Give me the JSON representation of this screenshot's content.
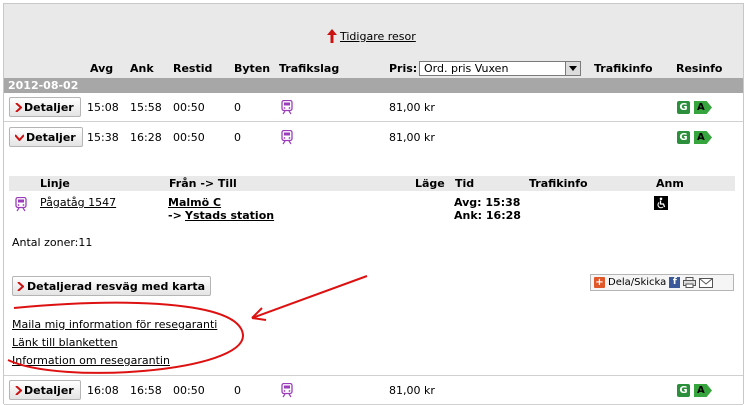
{
  "top": {
    "earlier_label": "Tidigare resor"
  },
  "columns": {
    "dep": "Avg",
    "arr": "Ank",
    "travel_time": "Restid",
    "changes": "Byten",
    "traffic_type": "Trafikslag",
    "price": "Pris:",
    "traffic_info": "Trafikinfo",
    "journey_info": "Resinfo"
  },
  "price_select": {
    "value": "Ord. pris Vuxen"
  },
  "date": "2012-08-02",
  "trips": [
    {
      "details_label": "Detaljer",
      "dep": "15:08",
      "arr": "15:58",
      "duration": "00:50",
      "changes": "0",
      "price": "81,00 kr",
      "badge_g": "G",
      "badge_a": "A"
    },
    {
      "details_label": "Detaljer",
      "dep": "15:38",
      "arr": "16:28",
      "duration": "00:50",
      "changes": "0",
      "price": "81,00 kr",
      "badge_g": "G",
      "badge_a": "A"
    },
    {
      "details_label": "Detaljer",
      "dep": "16:08",
      "arr": "16:58",
      "duration": "00:50",
      "changes": "0",
      "price": "81,00 kr",
      "badge_g": "G",
      "badge_a": "A"
    }
  ],
  "details": {
    "headers": {
      "line": "Linje",
      "from_to": "Från -> Till",
      "platform": "Läge",
      "time": "Tid",
      "traffic_info": "Trafikinfo",
      "note": "Anm"
    },
    "line": "Pågatåg 1547",
    "from": "Malmö C",
    "to_prefix": "->",
    "to": "Ystads station",
    "dep_time": "Avg: 15:38",
    "arr_time": "Ank: 16:28",
    "zones": "Antal zoner:11",
    "map_button": "Detaljerad resväg med karta",
    "share_label": "Dela/Skicka",
    "links": [
      "Maila mig information för resegaranti",
      "Länk till blanketten",
      "Information om resegarantin"
    ]
  },
  "colors": {
    "accent_red": "#cc1111",
    "train_purple": "#9b3dbb",
    "green_badge": "#2c8f3c"
  }
}
